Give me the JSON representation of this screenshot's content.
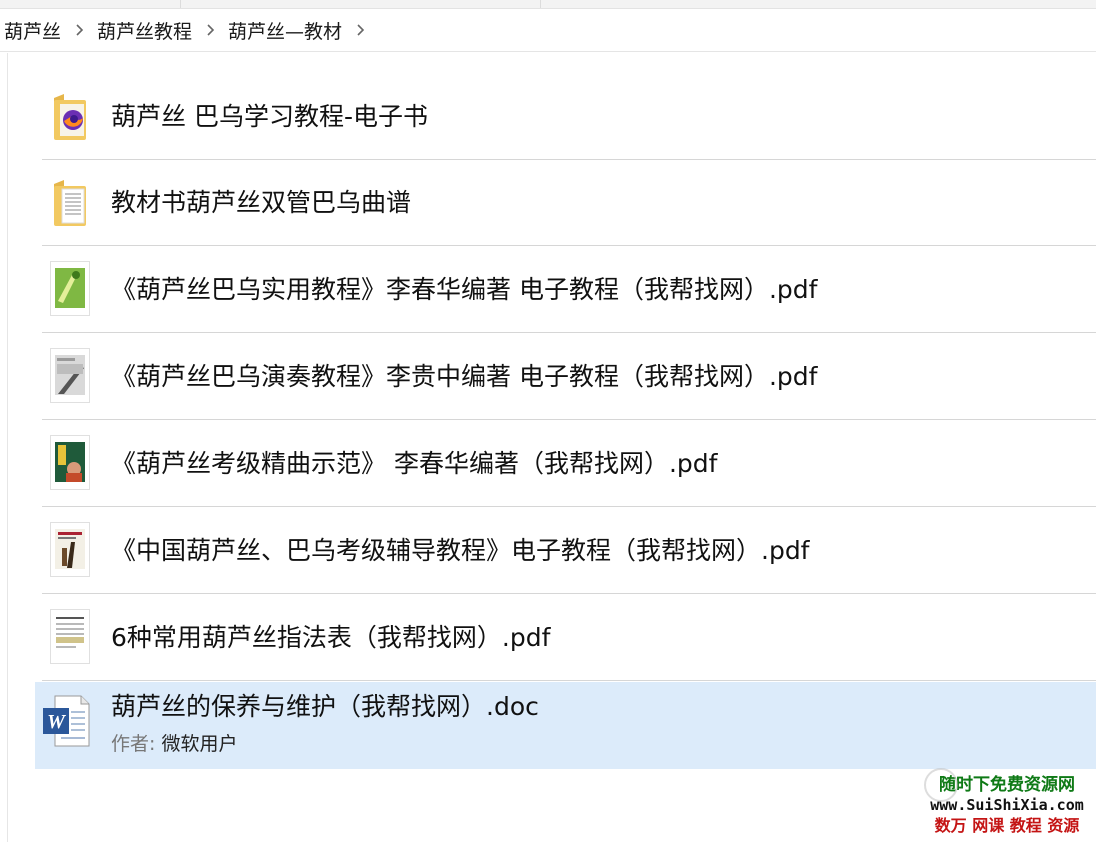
{
  "breadcrumb": {
    "items": [
      "葫芦丝",
      "葫芦丝教程",
      "葫芦丝—教材"
    ]
  },
  "files": [
    {
      "name": "葫芦丝 巴乌学习教程-电子书",
      "type": "folder-firefox-icon"
    },
    {
      "name": "教材书葫芦丝双管巴乌曲谱",
      "type": "folder-docs-icon"
    },
    {
      "name": "《葫芦丝巴乌实用教程》李春华编著 电子教程（我帮找网）.pdf",
      "type": "pdf-thumb-green"
    },
    {
      "name": "《葫芦丝巴乌演奏教程》李贵中编著 电子教程（我帮找网）.pdf",
      "type": "pdf-thumb-gray"
    },
    {
      "name": "《葫芦丝考级精曲示范》 李春华编著（我帮找网）.pdf",
      "type": "pdf-thumb-darkgreen"
    },
    {
      "name": "《中国葫芦丝、巴乌考级辅导教程》电子教程（我帮找网）.pdf",
      "type": "pdf-thumb-cover"
    },
    {
      "name": "6种常用葫芦丝指法表（我帮找网）.pdf",
      "type": "pdf-thumb-table"
    },
    {
      "name": "葫芦丝的保养与维护（我帮找网）.doc",
      "type": "word-doc-icon",
      "meta_label": "作者:",
      "meta_value": "微软用户"
    }
  ],
  "watermark": {
    "line1": "随时下免费资源网",
    "line2": "www.SuiShiXia.com",
    "line3": "数万 网课 教程 资源"
  },
  "colors": {
    "selected_bg": "#dcebfa",
    "watermark_green": "#0f7a16",
    "watermark_red": "#c41414"
  }
}
